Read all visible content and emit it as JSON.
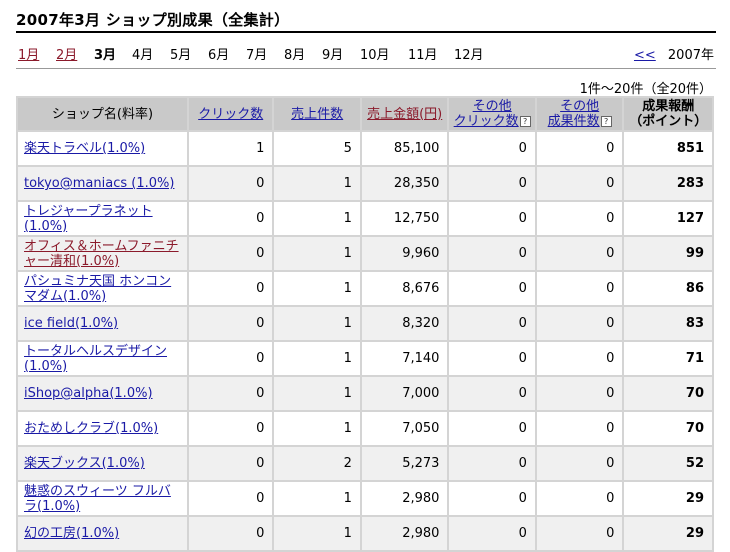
{
  "page": {
    "title": "2007年3月 ショップ別成果（全集計）"
  },
  "months": [
    {
      "label": "1月",
      "state": "link"
    },
    {
      "label": "2月",
      "state": "link"
    },
    {
      "label": "3月",
      "state": "current"
    },
    {
      "label": "4月",
      "state": "plain"
    },
    {
      "label": "5月",
      "state": "plain"
    },
    {
      "label": "6月",
      "state": "plain"
    },
    {
      "label": "7月",
      "state": "plain"
    },
    {
      "label": "8月",
      "state": "plain"
    },
    {
      "label": "9月",
      "state": "plain"
    },
    {
      "label": "10月",
      "state": "plain"
    },
    {
      "label": "11月",
      "state": "plain"
    },
    {
      "label": "12月",
      "state": "plain"
    }
  ],
  "year_nav": {
    "prev_label": "<<",
    "year": "2007年"
  },
  "result_count": "1件～20件（全20件）",
  "table": {
    "headers": {
      "shop": "ショップ名(料率)",
      "clicks": "クリック数",
      "sales_count": "売上件数",
      "sales_amount": "売上金額(円)",
      "other_clicks_1": "その他",
      "other_clicks_2": "クリック数",
      "other_results_1": "その他",
      "other_results_2": "成果件数",
      "reward_1": "成果報酬",
      "reward_2": "（ポイント）",
      "help_mark": "?"
    },
    "rows": [
      {
        "shop": "楽天トラベル(1.0%)",
        "clicks": "1",
        "sales_count": "5",
        "sales_amount": "85,100",
        "other_clicks": "0",
        "other_results": "0",
        "points": "851"
      },
      {
        "shop": "tokyo@maniacs (1.0%)",
        "clicks": "0",
        "sales_count": "1",
        "sales_amount": "28,350",
        "other_clicks": "0",
        "other_results": "0",
        "points": "283"
      },
      {
        "shop": "トレジャープラネット (1.0%)",
        "clicks": "0",
        "sales_count": "1",
        "sales_amount": "12,750",
        "other_clicks": "0",
        "other_results": "0",
        "points": "127"
      },
      {
        "shop": "オフィス＆ホームファニチャー清和(1.0%)",
        "clicks": "0",
        "sales_count": "1",
        "sales_amount": "9,960",
        "other_clicks": "0",
        "other_results": "0",
        "points": "99",
        "visited": true
      },
      {
        "shop": "パシュミナ天国 ホンコンマダム(1.0%)",
        "clicks": "0",
        "sales_count": "1",
        "sales_amount": "8,676",
        "other_clicks": "0",
        "other_results": "0",
        "points": "86"
      },
      {
        "shop": "ice field(1.0%)",
        "clicks": "0",
        "sales_count": "1",
        "sales_amount": "8,320",
        "other_clicks": "0",
        "other_results": "0",
        "points": "83"
      },
      {
        "shop": "トータルヘルスデザイン (1.0%)",
        "clicks": "0",
        "sales_count": "1",
        "sales_amount": "7,140",
        "other_clicks": "0",
        "other_results": "0",
        "points": "71"
      },
      {
        "shop": "iShop@alpha(1.0%)",
        "clicks": "0",
        "sales_count": "1",
        "sales_amount": "7,000",
        "other_clicks": "0",
        "other_results": "0",
        "points": "70"
      },
      {
        "shop": "おためしクラブ(1.0%)",
        "clicks": "0",
        "sales_count": "1",
        "sales_amount": "7,050",
        "other_clicks": "0",
        "other_results": "0",
        "points": "70"
      },
      {
        "shop": "楽天ブックス(1.0%)",
        "clicks": "0",
        "sales_count": "2",
        "sales_amount": "5,273",
        "other_clicks": "0",
        "other_results": "0",
        "points": "52"
      },
      {
        "shop": "魅惑のスウィーツ フルバラ(1.0%)",
        "clicks": "0",
        "sales_count": "1",
        "sales_amount": "2,980",
        "other_clicks": "0",
        "other_results": "0",
        "points": "29"
      },
      {
        "shop": "幻の工房(1.0%)",
        "clicks": "0",
        "sales_count": "1",
        "sales_amount": "2,980",
        "other_clicks": "0",
        "other_results": "0",
        "points": "29"
      }
    ]
  },
  "colors": {
    "link": "#1a1aa6",
    "visited_link": "#8b1a2b",
    "header_bg": "#c9c9c9",
    "row_alt": "#f0f0f0"
  }
}
